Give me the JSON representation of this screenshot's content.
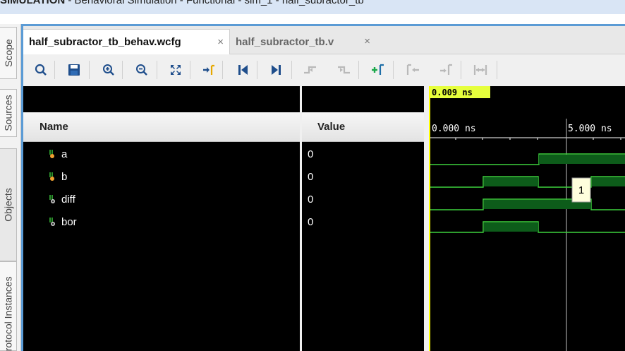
{
  "window_title": {
    "bold": "SIMULATION",
    "rest": " - Behavioral Simulation - Functional - sim_1 - half_subractor_tb"
  },
  "side_tabs": [
    "Scope",
    "Sources",
    "Objects",
    "Protocol Instances"
  ],
  "tabs": [
    {
      "label": "half_subractor_tb_behav.wcfg",
      "active": true,
      "close": "×"
    },
    {
      "label": "half_subractor_tb.v",
      "active": false,
      "close": "×"
    }
  ],
  "toolbar_icons": [
    "search-icon",
    "save-icon",
    "zoom-in-icon",
    "zoom-out-icon",
    "zoom-fit-icon",
    "go-to-cursor-icon",
    "go-to-start-icon",
    "go-to-end-icon",
    "previous-transition-icon",
    "next-transition-icon",
    "add-marker-icon",
    "previous-marker-icon",
    "next-marker-icon",
    "swap-cursors-icon"
  ],
  "columns": {
    "name": "Name",
    "value": "Value"
  },
  "signals": [
    {
      "name": "a",
      "value": "0",
      "kind": "input"
    },
    {
      "name": "b",
      "value": "0",
      "kind": "input"
    },
    {
      "name": "diff",
      "value": "0",
      "kind": "output"
    },
    {
      "name": "bor",
      "value": "0",
      "kind": "output"
    }
  ],
  "waveform": {
    "cursor_time": "0.009 ns",
    "time_labels": [
      "0.000 ns",
      "5.000 ns"
    ],
    "marker_tooltip": "1",
    "colors": {
      "wave": "#3ed13e",
      "fill": "#0d5c1a",
      "cursor": "#ffff00",
      "label_bg": "#e6ff3c"
    }
  }
}
